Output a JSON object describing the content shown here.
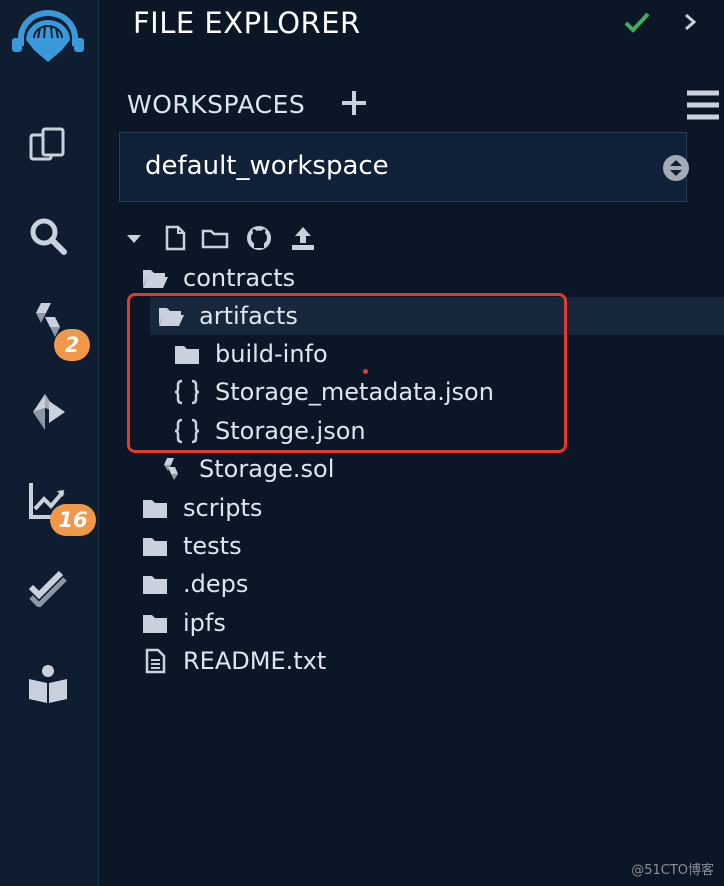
{
  "sidebar": {
    "badges": {
      "solidity": "2",
      "analysis": "16"
    }
  },
  "panel": {
    "title": "FILE EXPLORER",
    "workspaces_label": "WORKSPACES",
    "workspace_selected": "default_workspace"
  },
  "tree": {
    "contracts": "contracts",
    "artifacts": "artifacts",
    "build_info": "build-info",
    "storage_metadata": "Storage_metadata.json",
    "storage_json": "Storage.json",
    "storage_sol": "Storage.sol",
    "scripts": "scripts",
    "tests": "tests",
    "deps": ".deps",
    "ipfs": "ipfs",
    "readme": "README.txt"
  },
  "watermark": "@51CTO博客",
  "colors": {
    "accent": "#2f8fd0",
    "badge": "#f0974a",
    "check": "#3fae59",
    "highlight": "#e03b2e"
  }
}
